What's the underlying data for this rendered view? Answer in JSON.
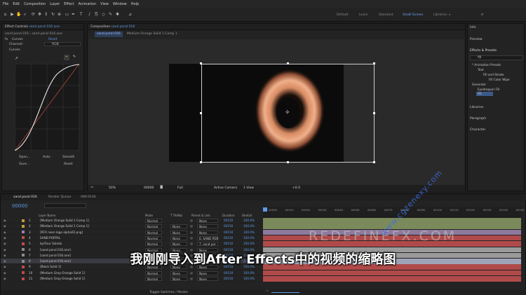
{
  "menu": [
    "File",
    "Edit",
    "Composition",
    "Layer",
    "Effect",
    "Animation",
    "View",
    "Window",
    "Help"
  ],
  "workspaces": [
    "Default",
    "Learn",
    "Standard",
    "Small Screen",
    "Libraries"
  ],
  "active_workspace": "Small Screen",
  "effect_controls": {
    "tab": "Effect Controls",
    "tab_layer": "sand poral 016 ane",
    "breadcrumb": "sand poral 016 › sand poral 016.ane",
    "effect_name": "Curves",
    "reset": "Reset",
    "channel_label": "Channel:",
    "channel_value": "RGB",
    "curves_label": "Curves",
    "buttons": [
      "Open...",
      "Auto",
      "Smooth",
      "Save...",
      "Reset"
    ]
  },
  "composition": {
    "tab_label": "Composition",
    "tab_name": "sand poral 016",
    "sub_tabs": [
      "sand poral 016",
      "Medium Orange Solid 1 Comp 1"
    ],
    "footer": [
      "50%",
      "00000",
      "Full",
      "Active Camera",
      "1 View",
      "+0.0"
    ]
  },
  "right_panel": {
    "top_items": [
      "Info",
      "Preview"
    ],
    "effects_title": "Effects & Presets",
    "search_value": "fill",
    "tree": [
      "* Animation Presets",
      "Text",
      "Fill and Stroke",
      "Fill Color Wipe",
      "Generate",
      "Eyedropper Fill",
      "Fill"
    ],
    "bottom_items": [
      "Libraries",
      "Paragraph",
      "Character"
    ]
  },
  "timeline": {
    "tabs": [
      "sand poral 016",
      "Render Queue",
      "006-0144"
    ],
    "timecode": "00000",
    "columns": [
      "Layer Name",
      "Mode",
      "T TrkMat",
      "Parent & Link",
      "Duration",
      "Stretch"
    ],
    "ruler": [
      "00000",
      "00010",
      "00020",
      "00030",
      "00040",
      "00050",
      "00060",
      "00070",
      "00080",
      "00090",
      "00100",
      "00110",
      "00120",
      "00130",
      "00140",
      "00150"
    ],
    "layers": [
      {
        "num": "1",
        "name": "[Medium Orange Solid 1 Comp 1]",
        "mode": "Normal",
        "trk": "",
        "parent": "None",
        "dur": "00150",
        "str": "100.0%",
        "color": "#c79b3a",
        "bar": "#7a8a5a"
      },
      {
        "num": "2",
        "name": "[Medium Orange Solid 1 Comp 1]",
        "mode": "Normal",
        "trk": "None",
        "parent": "None",
        "dur": "00150",
        "str": "100.0%",
        "color": "#c79b3a",
        "bar": "#7a8a5a"
      },
      {
        "num": "3",
        "name": "[RFX neon logo alpha02.png]",
        "mode": "Normal",
        "trk": "None",
        "parent": "None",
        "dur": "00150",
        "str": "100.0%",
        "color": "#9a7fb5",
        "bar": "#8e7a9e"
      },
      {
        "num": "4",
        "name": "SAND PORTAL",
        "mode": "Normal",
        "trk": "None",
        "parent": "6. SAND POR",
        "dur": "00150",
        "str": "100.0%",
        "color": "#c04a4a",
        "bar": "#b04a4a"
      },
      {
        "num": "5",
        "name": "by/Four Solodo",
        "mode": "Normal",
        "trk": "None",
        "parent": "7. sand por",
        "dur": "00150",
        "str": "100.0%",
        "color": "#c04a4a",
        "bar": "#b04a4a"
      },
      {
        "num": "6",
        "name": "[sand poral 016.ane]",
        "mode": "Normal",
        "trk": "None",
        "parent": "None",
        "dur": "00150",
        "str": "100.0%",
        "color": "#8c8c8c",
        "bar": "#9a9a9a"
      },
      {
        "num": "7",
        "name": "[sand poral 016.ane]",
        "mode": "Normal",
        "trk": "None",
        "parent": "None",
        "dur": "00150",
        "str": "100.0%",
        "color": "#8c8c8c",
        "bar": "#9a9a9a"
      },
      {
        "num": "8",
        "name": "[sand poral 016.ane]",
        "mode": "Normal",
        "trk": "None",
        "parent": "None",
        "dur": "00150",
        "str": "100.0%",
        "color": "#8c8c8c",
        "bar": "#9fa3b8"
      },
      {
        "num": "9",
        "name": "[Black Solid 1]",
        "mode": "Normal",
        "trk": "None",
        "parent": "None",
        "dur": "00150",
        "str": "100.0%",
        "color": "#c04a4a",
        "bar": "#b04a4a"
      },
      {
        "num": "10",
        "name": "[Medium Gray-Orange Solid 1]",
        "mode": "Normal",
        "trk": "None",
        "parent": "None",
        "dur": "00150",
        "str": "100.0%",
        "color": "#c04a4a",
        "bar": "#b04a4a"
      },
      {
        "num": "11",
        "name": "[Medium Gray-Orange Solid 1]",
        "mode": "Normal",
        "trk": "None",
        "parent": "None",
        "dur": "00150",
        "str": "100.0%",
        "color": "#c04a4a",
        "bar": "#b04a4a"
      }
    ],
    "footer_label": "Toggle Switches / Modes"
  },
  "overlay": {
    "subtitle": "我刚刚导入到After Effects中的视频的缩略图",
    "watermark_text": "REDEFINEFX.COM",
    "watermark_url": "www.cgzenexy.com"
  }
}
